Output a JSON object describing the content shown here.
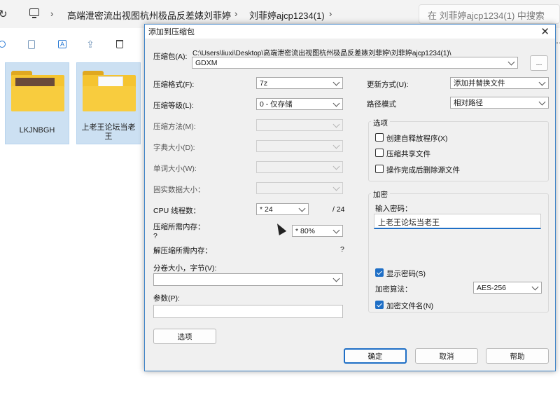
{
  "explorer": {
    "breadcrumb": [
      "高端泄密流出视图杭州极品反差婊刘菲婷",
      "刘菲婷ajcp1234(1)"
    ],
    "search_placeholder": "在 刘菲婷ajcp1234(1) 中搜索",
    "items": [
      {
        "name": "LKJNBGH"
      },
      {
        "name": "上老王论坛当老王"
      }
    ]
  },
  "dialog": {
    "title": "添加到压缩包",
    "archive_label": "压缩包(A):",
    "archive_path": "C:\\Users\\liuxi\\Desktop\\高端泄密流出视图杭州极品反差婊刘菲婷\\刘菲婷ajcp1234(1)\\",
    "archive_name": "GDXM",
    "browse_label": "...",
    "format_label": "压缩格式(F):",
    "format_value": "7z",
    "level_label": "压缩等级(L):",
    "level_value": "0 - 仅存储",
    "method_label": "压缩方法(M):",
    "dict_label": "字典大小(D):",
    "word_label": "单词大小(W):",
    "solid_label": "固实数据大小：",
    "threads_label": "CPU 线程数：",
    "threads_value": "* 24",
    "threads_total": "/ 24",
    "mem_label": "压缩所需内存：",
    "mem_q": "?",
    "mem_value": "* 80%",
    "decomp_label": "解压缩所需内存：",
    "decomp_value": "?",
    "split_label": "分卷大小，字节(V):",
    "params_label": "参数(P):",
    "options_button": "选项",
    "update_label": "更新方式(U):",
    "update_value": "添加并替换文件",
    "pathmode_label": "路径模式",
    "pathmode_value": "相对路径",
    "options_group": "选项",
    "opt_sfx": "创建自释放程序(X)",
    "opt_shared": "压缩共享文件",
    "opt_delete": "操作完成后删除源文件",
    "enc_group": "加密",
    "pwd_label": "输入密码：",
    "pwd_value": "上老王论坛当老王",
    "show_pwd": "显示密码(S)",
    "enc_method_label": "加密算法：",
    "enc_method_value": "AES-256",
    "enc_names": "加密文件名(N)",
    "ok": "确定",
    "cancel": "取消",
    "help": "帮助"
  }
}
